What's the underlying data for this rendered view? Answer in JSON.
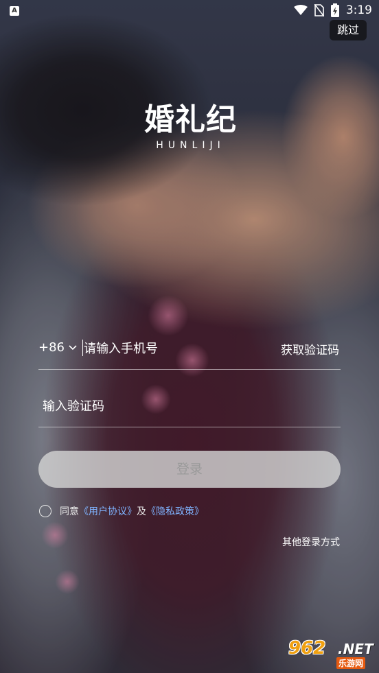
{
  "status_bar": {
    "app_icon": "A",
    "time": "3:19",
    "icons": [
      "wifi-icon",
      "no-sim-icon",
      "battery-charging-icon"
    ]
  },
  "skip_label": "跳过",
  "logo": {
    "chinese": "婚礼纪",
    "english": "HUNLIJI"
  },
  "login_form": {
    "country_code": "+86",
    "phone_placeholder": "请输入手机号",
    "get_code_label": "获取验证码",
    "code_placeholder": "输入验证码",
    "login_label": "登录"
  },
  "agreement": {
    "prefix": "同意",
    "user_agreement": "《用户协议》",
    "joiner": "及",
    "privacy_policy": "《隐私政策》"
  },
  "other_login_label": "其他登录方式",
  "watermark": {
    "number": "962",
    "suffix": ".NET",
    "site": "乐游网"
  },
  "colors": {
    "link": "#7fb3ff",
    "login_button_bg": "#d2d2d2",
    "login_text": "#9a9a9a"
  }
}
